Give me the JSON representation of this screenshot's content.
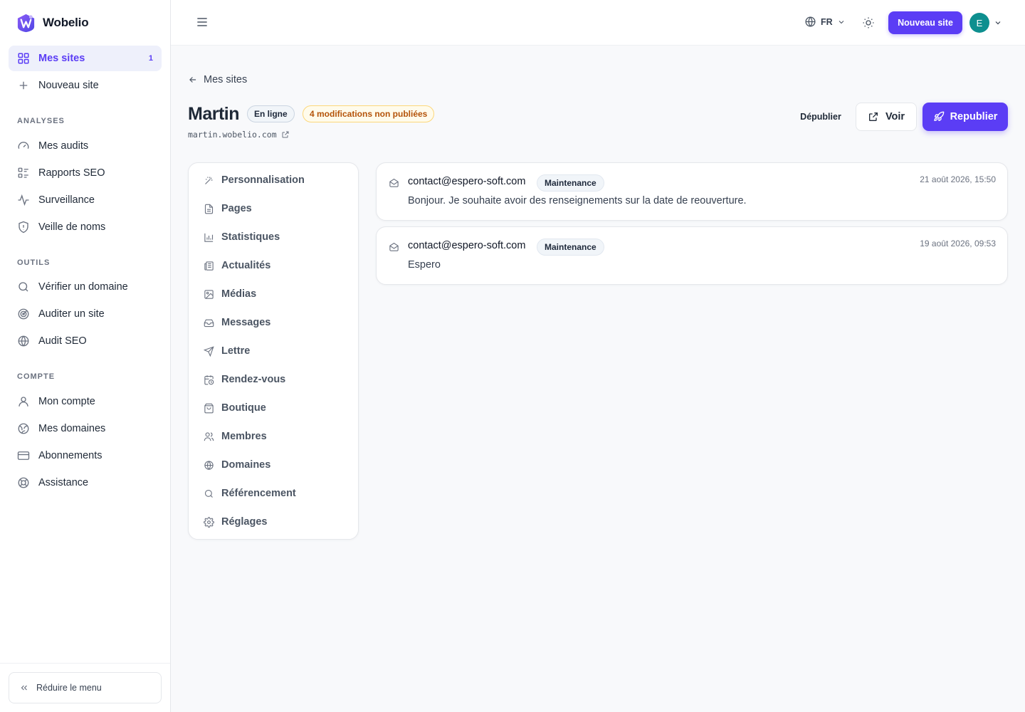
{
  "brand": {
    "name": "Wobelio"
  },
  "sidebar": {
    "my_sites": {
      "label": "Mes sites",
      "badge": "1"
    },
    "new_site": {
      "label": "Nouveau site"
    },
    "sections": {
      "analyses": "ANALYSES",
      "outils": "OUTILS",
      "compte": "COMPTE"
    },
    "analyses_items": [
      {
        "label": "Mes audits",
        "icon": "gauge-icon"
      },
      {
        "label": "Rapports SEO",
        "icon": "report-icon"
      },
      {
        "label": "Surveillance",
        "icon": "activity-icon"
      },
      {
        "label": "Veille de noms",
        "icon": "shield-icon"
      }
    ],
    "outils_items": [
      {
        "label": "Vérifier un domaine",
        "icon": "search-icon"
      },
      {
        "label": "Auditer un site",
        "icon": "radar-icon"
      },
      {
        "label": "Audit SEO",
        "icon": "globe-icon"
      }
    ],
    "compte_items": [
      {
        "label": "Mon compte",
        "icon": "user-icon"
      },
      {
        "label": "Mes domaines",
        "icon": "globe-grid-icon"
      },
      {
        "label": "Abonnements",
        "icon": "credit-card-icon"
      },
      {
        "label": "Assistance",
        "icon": "lifebuoy-icon"
      }
    ],
    "collapse_label": "Réduire le menu"
  },
  "topbar": {
    "language": "FR",
    "new_site_label": "Nouveau site",
    "avatar_initial": "E"
  },
  "header": {
    "back_label": "Mes sites",
    "site_name": "Martin",
    "status_badge": "En ligne",
    "changes_badge": "4 modifications non publiées",
    "site_url": "martin.wobelio.com",
    "unpublish_label": "Dépublier",
    "view_label": "Voir",
    "republish_label": "Republier"
  },
  "site_menu": [
    {
      "label": "Personnalisation",
      "icon": "magic-wand-icon"
    },
    {
      "label": "Pages",
      "icon": "file-icon"
    },
    {
      "label": "Statistiques",
      "icon": "bar-chart-icon"
    },
    {
      "label": "Actualités",
      "icon": "newspaper-icon"
    },
    {
      "label": "Médias",
      "icon": "image-icon"
    },
    {
      "label": "Messages",
      "icon": "inbox-icon"
    },
    {
      "label": "Lettre",
      "icon": "send-icon"
    },
    {
      "label": "Rendez-vous",
      "icon": "calendar-clock-icon"
    },
    {
      "label": "Boutique",
      "icon": "shopping-bag-icon"
    },
    {
      "label": "Membres",
      "icon": "users-icon"
    },
    {
      "label": "Domaines",
      "icon": "globe-icon"
    },
    {
      "label": "Référencement",
      "icon": "search-icon"
    },
    {
      "label": "Réglages",
      "icon": "gear-icon"
    }
  ],
  "messages": [
    {
      "from": "contact@espero-soft.com",
      "tag": "Maintenance",
      "date": "21 août 2026, 15:50",
      "body": "Bonjour. Je souhaite avoir des renseignements sur la date de reouverture."
    },
    {
      "from": "contact@espero-soft.com",
      "tag": "Maintenance",
      "date": "19 août 2026, 09:53",
      "body": "Espero"
    }
  ],
  "colors": {
    "accent": "#5b3df5",
    "online_badge_bg": "#f1f5f9",
    "changes_badge_bg": "#fffbeb",
    "changes_badge_text": "#b45309",
    "avatar_bg": "#0e8f8f"
  }
}
